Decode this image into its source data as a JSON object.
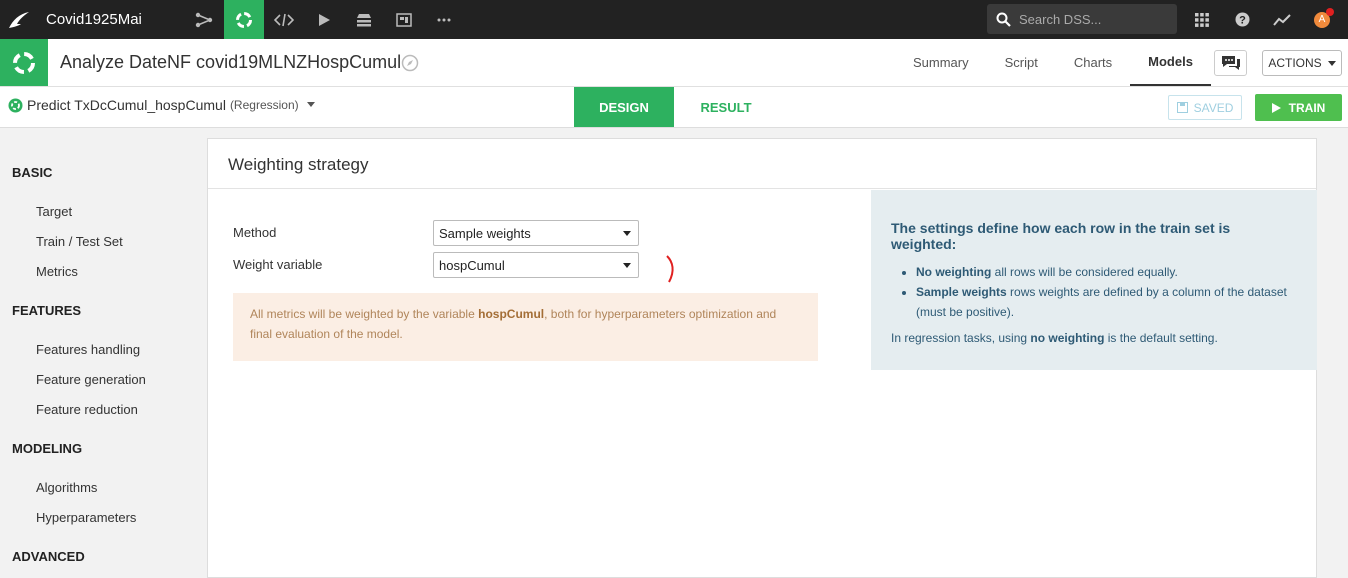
{
  "topnav": {
    "project_name": "Covid1925Mai",
    "search_placeholder": "Search DSS...",
    "avatar_letter": "A",
    "icons": [
      "flow-icon",
      "lab-icon",
      "code-icon",
      "run-icon",
      "stack-icon",
      "dashboard-icon",
      "more-icon",
      "grid-icon",
      "help-icon",
      "activity-icon"
    ]
  },
  "header": {
    "title": "Analyze DateNF covid19MLNZHospCumul",
    "tabs": [
      "Summary",
      "Script",
      "Charts",
      "Models"
    ],
    "active_tab": "Models",
    "actions_label": "ACTIONS"
  },
  "modelbar": {
    "name": "Predict TxDcCumul_hospCumul",
    "kind": "(Regression)",
    "design_label": "DESIGN",
    "result_label": "RESULT",
    "saved_label": "SAVED",
    "train_label": "TRAIN"
  },
  "sidebar": {
    "sections": [
      {
        "title": "BASIC",
        "items": [
          "Target",
          "Train / Test Set",
          "Metrics"
        ]
      },
      {
        "title": "FEATURES",
        "items": [
          "Features handling",
          "Feature generation",
          "Feature reduction"
        ]
      },
      {
        "title": "MODELING",
        "items": [
          "Algorithms",
          "Hyperparameters"
        ]
      },
      {
        "title": "ADVANCED",
        "items": []
      }
    ]
  },
  "main": {
    "title": "Weighting strategy",
    "method_label": "Method",
    "method_value": "Sample weights",
    "weight_label": "Weight variable",
    "weight_value": "hospCumul",
    "warning": {
      "prefix": "All metrics will be weighted by the variable ",
      "variable": "hospCumul",
      "suffix": ", both for hyperparameters optimization and final evaluation of the model."
    },
    "info": {
      "heading": "The settings define how each row in the train set is weighted:",
      "items": [
        {
          "bold": "No weighting",
          "text": " all rows will be considered equally."
        },
        {
          "bold": "Sample weights",
          "text": " rows weights are defined by a column of the dataset (must be positive)."
        }
      ],
      "note_prefix": "In regression tasks, using ",
      "note_bold": "no weighting",
      "note_suffix": " is the default setting."
    }
  },
  "colors": {
    "accent": "#2db15f",
    "topbar": "#222222",
    "train": "#4fbf4f",
    "warning_bg": "#fbeee4",
    "info_bg": "#e5edf0"
  }
}
